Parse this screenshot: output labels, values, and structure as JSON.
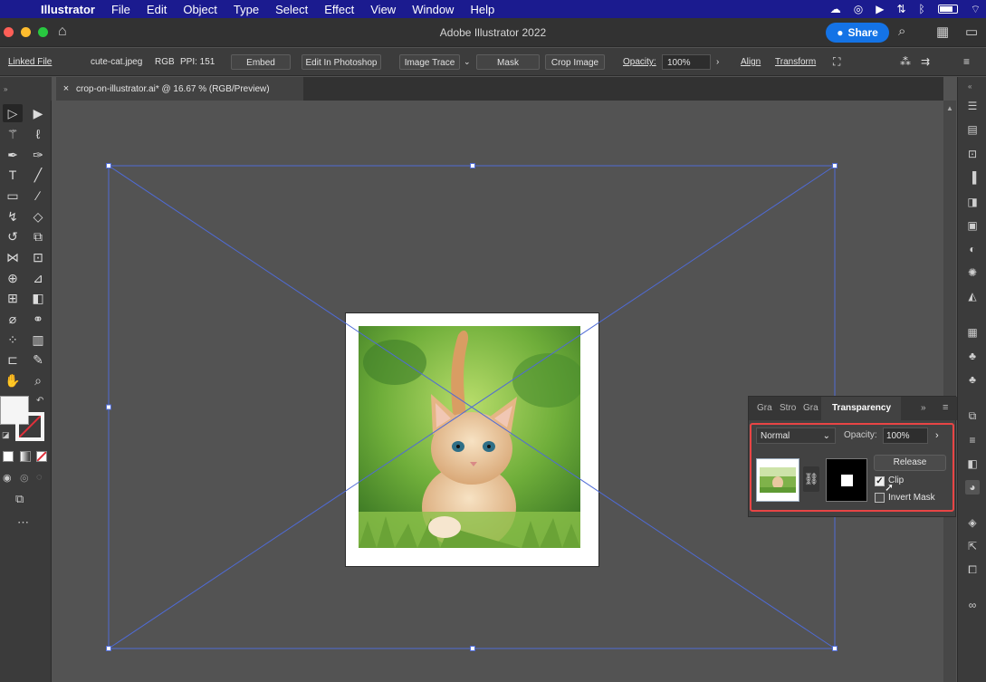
{
  "menubar": {
    "app_name": "Illustrator",
    "items": [
      "File",
      "Edit",
      "Object",
      "Type",
      "Select",
      "Effect",
      "View",
      "Window",
      "Help"
    ]
  },
  "titlebar": {
    "title": "Adobe Illustrator 2022",
    "share_label": "Share"
  },
  "controlbar": {
    "linked_file": "Linked File",
    "file_name": "cute-cat.jpeg",
    "color_mode": "RGB",
    "ppi": "PPI: 151",
    "embed": "Embed",
    "edit_in_photoshop": "Edit In Photoshop",
    "image_trace": "Image Trace",
    "mask": "Mask",
    "crop_image": "Crop Image",
    "opacity_label": "Opacity:",
    "opacity_value": "100%",
    "align": "Align",
    "transform": "Transform"
  },
  "document": {
    "tab_title": "crop-on-illustrator.ai* @ 16.67 % (RGB/Preview)"
  },
  "transparency_panel": {
    "tabs": [
      "Gra",
      "Stro",
      "Gra",
      "Transparency"
    ],
    "blend_mode": "Normal",
    "opacity_label": "Opacity:",
    "opacity_value": "100%",
    "release": "Release",
    "clip_label": "Clip",
    "clip_checked": true,
    "invert_mask_label": "Invert Mask",
    "invert_mask_checked": false
  },
  "colors": {
    "menubar": "#1b1b8f",
    "accent": "#1473e6",
    "selection": "#4f6bd6",
    "highlight_box": "#e84545"
  }
}
